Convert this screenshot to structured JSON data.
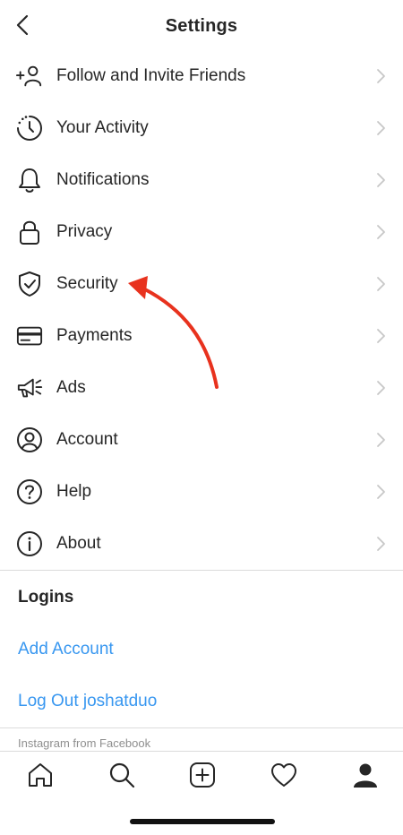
{
  "header": {
    "title": "Settings",
    "back_icon": "chevron-left-icon"
  },
  "menu": [
    {
      "label": "Follow and Invite Friends",
      "icon": "add-person-icon"
    },
    {
      "label": "Your Activity",
      "icon": "activity-clock-icon"
    },
    {
      "label": "Notifications",
      "icon": "bell-icon"
    },
    {
      "label": "Privacy",
      "icon": "lock-icon"
    },
    {
      "label": "Security",
      "icon": "shield-check-icon"
    },
    {
      "label": "Payments",
      "icon": "credit-card-icon"
    },
    {
      "label": "Ads",
      "icon": "megaphone-icon"
    },
    {
      "label": "Account",
      "icon": "account-circle-icon"
    },
    {
      "label": "Help",
      "icon": "help-icon"
    },
    {
      "label": "About",
      "icon": "info-icon"
    }
  ],
  "logins": {
    "title": "Logins",
    "add_account": "Add Account",
    "log_out": "Log Out joshatduo"
  },
  "footer": {
    "note": "Instagram from Facebook"
  },
  "tabbar": {
    "items": [
      "home-icon",
      "search-icon",
      "new-post-icon",
      "heart-icon",
      "profile-icon"
    ]
  },
  "annotation": {
    "arrow_color": "#e8321e",
    "points_to": "Security"
  },
  "colors": {
    "link": "#3897f0",
    "text": "#262626",
    "divider": "#dbdbdb",
    "secondary": "#8e8e8e"
  }
}
